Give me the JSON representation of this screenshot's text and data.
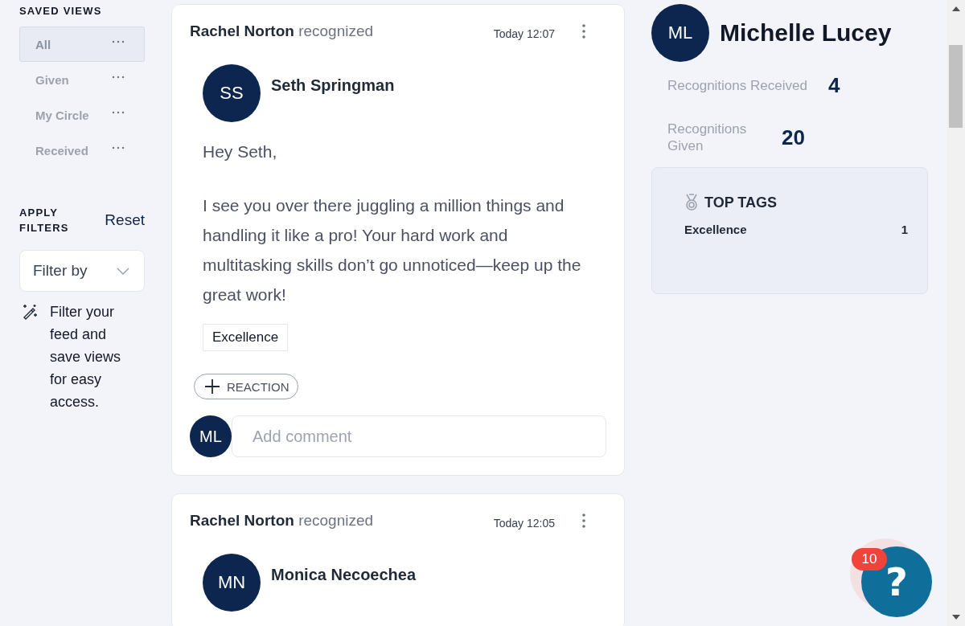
{
  "sidebar": {
    "saved_views_title": "SAVED VIEWS",
    "saved_views": [
      {
        "label": "All",
        "selected": true
      },
      {
        "label": "Given",
        "selected": false
      },
      {
        "label": "My Circle",
        "selected": false
      },
      {
        "label": "Received",
        "selected": false
      }
    ],
    "filters_title": "APPLY FILTERS",
    "reset": "Reset",
    "filter_dropdown": {
      "placeholder": "Filter by"
    },
    "hint": "Filter your feed and save views for easy access."
  },
  "posts": [
    {
      "author": "Rachel Norton",
      "action": "recognized",
      "time": "Today 12:07",
      "recipient": {
        "initials": "SS",
        "name": "Seth Springman"
      },
      "greeting": "Hey Seth,",
      "message": "I see you over there juggling a million things and handling it like a pro! Your hard work and multitasking skills don’t go unnoticed—keep up the great work!",
      "tags": [
        "Excellence"
      ],
      "reaction_button": "REACTION",
      "comment": {
        "initials": "ML",
        "placeholder": "Add comment"
      }
    },
    {
      "author": "Rachel Norton",
      "action": "recognized",
      "time": "Today 12:05",
      "recipient": {
        "initials": "MN",
        "name": "Monica Necoechea"
      }
    }
  ],
  "profile": {
    "initials": "ML",
    "name": "Michelle Lucey",
    "stats": [
      {
        "label": "Recognitions Received",
        "value": "4"
      },
      {
        "label": "Recognitions Given",
        "value": "20"
      }
    ],
    "top_tags": {
      "title": "TOP TAGS",
      "items": [
        {
          "name": "Excellence",
          "count": "1"
        }
      ]
    }
  },
  "help": {
    "label": "?",
    "badge": "10"
  }
}
